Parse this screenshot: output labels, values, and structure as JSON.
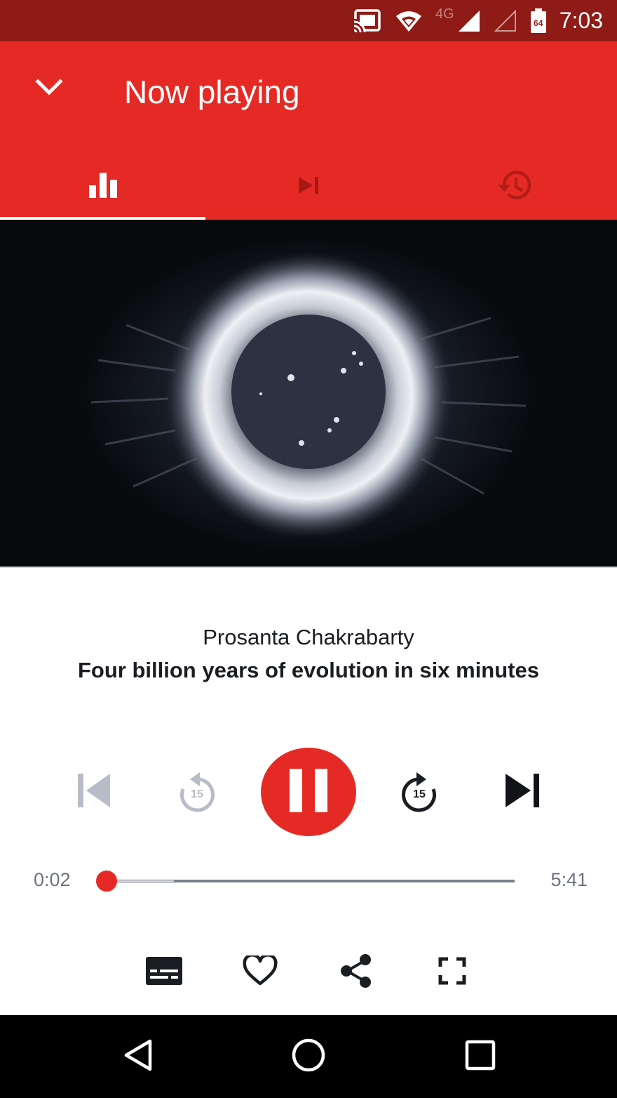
{
  "status_bar": {
    "time": "7:03",
    "network": "4G",
    "battery": "64",
    "icons": [
      "cast-icon",
      "wifi-icon",
      "signal-icon",
      "signal-empty-icon",
      "battery-icon"
    ]
  },
  "header": {
    "title": "Now playing",
    "collapse_icon": "chevron-down-icon",
    "tabs": [
      {
        "icon": "equalizer-icon",
        "selected": true
      },
      {
        "icon": "skip-next-icon",
        "selected": false
      },
      {
        "icon": "history-icon",
        "selected": false
      }
    ]
  },
  "artwork": {
    "description_icon": "nebula-artwork"
  },
  "talk": {
    "speaker": "Prosanta Chakrabarty",
    "title": "Four billion years of evolution in six minutes"
  },
  "controls": {
    "previous_icon": "skip-previous-icon",
    "rewind_icon": "replay-15-icon",
    "rewind_label": "15",
    "play_pause_icon": "pause-icon",
    "forward_icon": "forward-15-icon",
    "forward_label": "15",
    "next_icon": "skip-next-icon"
  },
  "progress": {
    "current": "0:02",
    "total": "5:41",
    "played_fraction": 0.006,
    "buffered_fraction": 0.17
  },
  "actions": [
    "subtitles-icon",
    "heart-icon",
    "share-icon",
    "fullscreen-icon"
  ],
  "colors": {
    "status_bar": "#8e1b16",
    "accent": "#e52a25",
    "text": "#1a1d22",
    "muted": "#6e7381",
    "disabled": "#b8bcc8"
  },
  "navigation": [
    "back-icon",
    "home-icon",
    "recents-icon"
  ]
}
